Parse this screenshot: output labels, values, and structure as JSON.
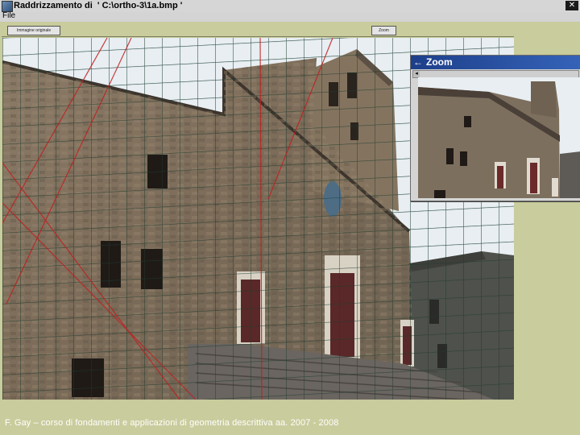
{
  "window": {
    "title": "Raddrizzamento di  ' C:\\ortho-3\\1a.bmp '",
    "close_glyph": "✕",
    "icon": "app-icon"
  },
  "menu": {
    "items": [
      "File"
    ]
  },
  "toolbar": {
    "left_button": "Immagine originale",
    "right_button": "Zoom"
  },
  "zoom_window": {
    "title": "Zoom",
    "back_arrow": "←",
    "scroll_arrow": "◂"
  },
  "footer": {
    "text": "F. Gay – corso di fondamenti e applicazioni di geometria descrittiva aa. 2007 - 2008"
  },
  "colors": {
    "background": "#c9cc9c",
    "grid_lines": "#1e3a2e",
    "guide_lines": "#c02020",
    "zoom_titlebar": "#1d3f8a"
  }
}
